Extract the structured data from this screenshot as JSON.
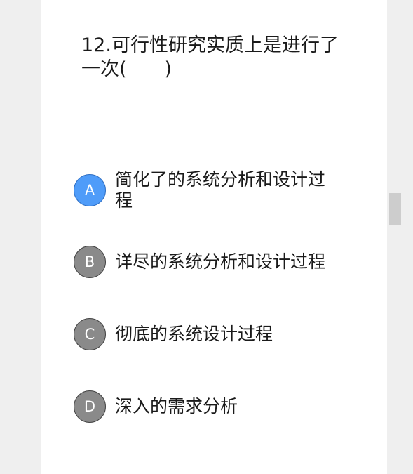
{
  "question": {
    "text": "12.可行性研究实质上是进行了一次(　　)"
  },
  "options": [
    {
      "letter": "A",
      "text": "简化了的系统分析和设计过程",
      "selected": true
    },
    {
      "letter": "B",
      "text": "详尽的系统分析和设计过程",
      "selected": false
    },
    {
      "letter": "C",
      "text": "彻底的系统设计过程",
      "selected": false
    },
    {
      "letter": "D",
      "text": "深入的需求分析",
      "selected": false
    }
  ],
  "colors": {
    "selected": "#4f9cf9",
    "unselected": "#8a8a8a",
    "card": "#ffffff",
    "background": "#efefef"
  }
}
